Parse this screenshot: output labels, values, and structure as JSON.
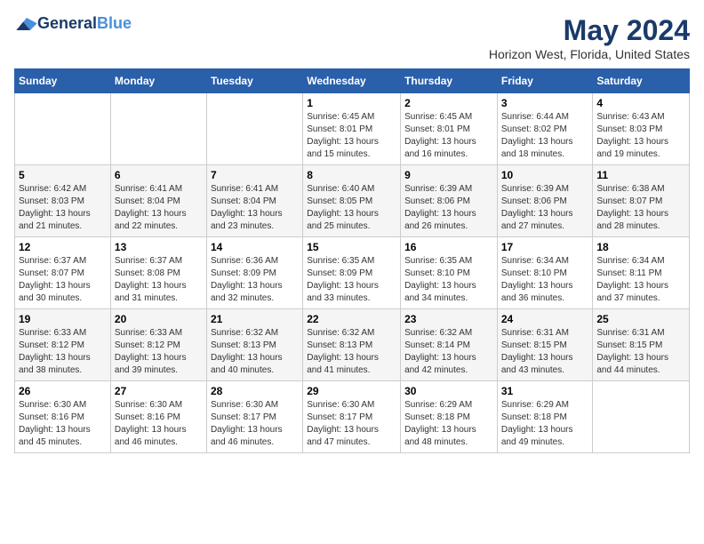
{
  "header": {
    "logo_general": "General",
    "logo_blue": "Blue",
    "month_year": "May 2024",
    "location": "Horizon West, Florida, United States"
  },
  "days_of_week": [
    "Sunday",
    "Monday",
    "Tuesday",
    "Wednesday",
    "Thursday",
    "Friday",
    "Saturday"
  ],
  "weeks": [
    [
      {
        "day": "",
        "info": ""
      },
      {
        "day": "",
        "info": ""
      },
      {
        "day": "",
        "info": ""
      },
      {
        "day": "1",
        "info": "Sunrise: 6:45 AM\nSunset: 8:01 PM\nDaylight: 13 hours\nand 15 minutes."
      },
      {
        "day": "2",
        "info": "Sunrise: 6:45 AM\nSunset: 8:01 PM\nDaylight: 13 hours\nand 16 minutes."
      },
      {
        "day": "3",
        "info": "Sunrise: 6:44 AM\nSunset: 8:02 PM\nDaylight: 13 hours\nand 18 minutes."
      },
      {
        "day": "4",
        "info": "Sunrise: 6:43 AM\nSunset: 8:03 PM\nDaylight: 13 hours\nand 19 minutes."
      }
    ],
    [
      {
        "day": "5",
        "info": "Sunrise: 6:42 AM\nSunset: 8:03 PM\nDaylight: 13 hours\nand 21 minutes."
      },
      {
        "day": "6",
        "info": "Sunrise: 6:41 AM\nSunset: 8:04 PM\nDaylight: 13 hours\nand 22 minutes."
      },
      {
        "day": "7",
        "info": "Sunrise: 6:41 AM\nSunset: 8:04 PM\nDaylight: 13 hours\nand 23 minutes."
      },
      {
        "day": "8",
        "info": "Sunrise: 6:40 AM\nSunset: 8:05 PM\nDaylight: 13 hours\nand 25 minutes."
      },
      {
        "day": "9",
        "info": "Sunrise: 6:39 AM\nSunset: 8:06 PM\nDaylight: 13 hours\nand 26 minutes."
      },
      {
        "day": "10",
        "info": "Sunrise: 6:39 AM\nSunset: 8:06 PM\nDaylight: 13 hours\nand 27 minutes."
      },
      {
        "day": "11",
        "info": "Sunrise: 6:38 AM\nSunset: 8:07 PM\nDaylight: 13 hours\nand 28 minutes."
      }
    ],
    [
      {
        "day": "12",
        "info": "Sunrise: 6:37 AM\nSunset: 8:07 PM\nDaylight: 13 hours\nand 30 minutes."
      },
      {
        "day": "13",
        "info": "Sunrise: 6:37 AM\nSunset: 8:08 PM\nDaylight: 13 hours\nand 31 minutes."
      },
      {
        "day": "14",
        "info": "Sunrise: 6:36 AM\nSunset: 8:09 PM\nDaylight: 13 hours\nand 32 minutes."
      },
      {
        "day": "15",
        "info": "Sunrise: 6:35 AM\nSunset: 8:09 PM\nDaylight: 13 hours\nand 33 minutes."
      },
      {
        "day": "16",
        "info": "Sunrise: 6:35 AM\nSunset: 8:10 PM\nDaylight: 13 hours\nand 34 minutes."
      },
      {
        "day": "17",
        "info": "Sunrise: 6:34 AM\nSunset: 8:10 PM\nDaylight: 13 hours\nand 36 minutes."
      },
      {
        "day": "18",
        "info": "Sunrise: 6:34 AM\nSunset: 8:11 PM\nDaylight: 13 hours\nand 37 minutes."
      }
    ],
    [
      {
        "day": "19",
        "info": "Sunrise: 6:33 AM\nSunset: 8:12 PM\nDaylight: 13 hours\nand 38 minutes."
      },
      {
        "day": "20",
        "info": "Sunrise: 6:33 AM\nSunset: 8:12 PM\nDaylight: 13 hours\nand 39 minutes."
      },
      {
        "day": "21",
        "info": "Sunrise: 6:32 AM\nSunset: 8:13 PM\nDaylight: 13 hours\nand 40 minutes."
      },
      {
        "day": "22",
        "info": "Sunrise: 6:32 AM\nSunset: 8:13 PM\nDaylight: 13 hours\nand 41 minutes."
      },
      {
        "day": "23",
        "info": "Sunrise: 6:32 AM\nSunset: 8:14 PM\nDaylight: 13 hours\nand 42 minutes."
      },
      {
        "day": "24",
        "info": "Sunrise: 6:31 AM\nSunset: 8:15 PM\nDaylight: 13 hours\nand 43 minutes."
      },
      {
        "day": "25",
        "info": "Sunrise: 6:31 AM\nSunset: 8:15 PM\nDaylight: 13 hours\nand 44 minutes."
      }
    ],
    [
      {
        "day": "26",
        "info": "Sunrise: 6:30 AM\nSunset: 8:16 PM\nDaylight: 13 hours\nand 45 minutes."
      },
      {
        "day": "27",
        "info": "Sunrise: 6:30 AM\nSunset: 8:16 PM\nDaylight: 13 hours\nand 46 minutes."
      },
      {
        "day": "28",
        "info": "Sunrise: 6:30 AM\nSunset: 8:17 PM\nDaylight: 13 hours\nand 46 minutes."
      },
      {
        "day": "29",
        "info": "Sunrise: 6:30 AM\nSunset: 8:17 PM\nDaylight: 13 hours\nand 47 minutes."
      },
      {
        "day": "30",
        "info": "Sunrise: 6:29 AM\nSunset: 8:18 PM\nDaylight: 13 hours\nand 48 minutes."
      },
      {
        "day": "31",
        "info": "Sunrise: 6:29 AM\nSunset: 8:18 PM\nDaylight: 13 hours\nand 49 minutes."
      },
      {
        "day": "",
        "info": ""
      }
    ]
  ]
}
